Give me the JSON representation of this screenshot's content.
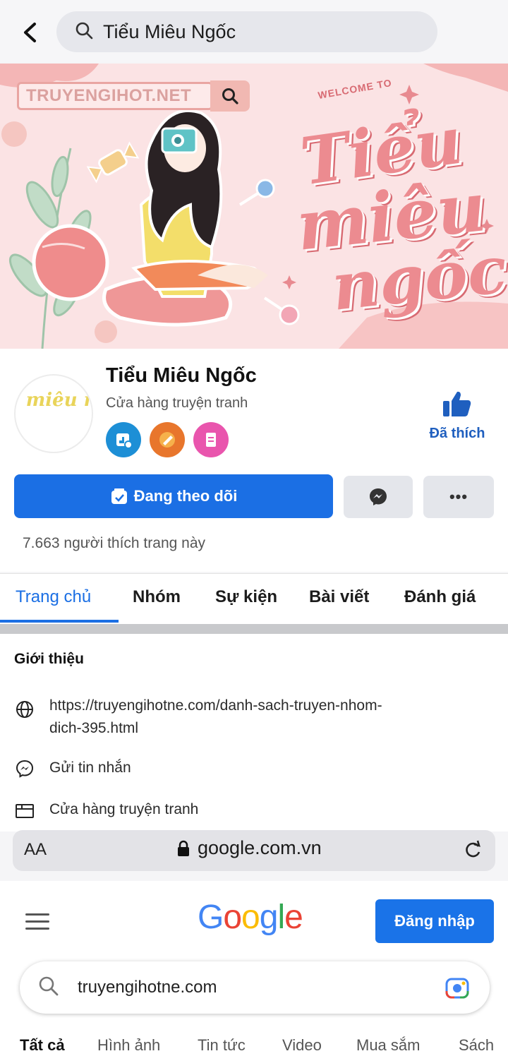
{
  "search_bar": {
    "query": "Tiểu Miêu Ngốc"
  },
  "cover": {
    "brand_text": "TRUYENGIHOT.NET",
    "welcome": "WELCOME TO",
    "script_lines": [
      "Tiểu",
      "miêu",
      "ngốc"
    ]
  },
  "page": {
    "name": "Tiểu Miêu Ngốc",
    "category": "Cửa hàng truyện tranh",
    "like_label": "Đã thích",
    "follow_label": "Đang theo dõi",
    "likes_text": "7.663 người thích trang này",
    "avatar_text": "Tiểu miêu ngốc"
  },
  "tabs": [
    "Trang chủ",
    "Nhóm",
    "Sự kiện",
    "Bài viết",
    "Đánh giá"
  ],
  "intro": {
    "heading": "Giới thiệu",
    "link_line1": "https://truyengihotne.com/danh-sach-truyen-nhom-",
    "link_line2": "dich-395.html",
    "message": "Gửi tin nhắn",
    "category": "Cửa hàng truyện tranh"
  },
  "browser": {
    "text_size": "AA",
    "domain": "google.com.vn"
  },
  "google": {
    "logo": "Google",
    "signin_label": "Đăng nhập",
    "query": "truyengihotne.com",
    "tabs": [
      "Tất cả",
      "Hình ảnh",
      "Tin tức",
      "Video",
      "Mua sắm",
      "Sách"
    ]
  },
  "colors": {
    "facebook_blue": "#1b6fe4",
    "google_blue": "#1a73e8",
    "cover_pink": "#ec8b90"
  }
}
